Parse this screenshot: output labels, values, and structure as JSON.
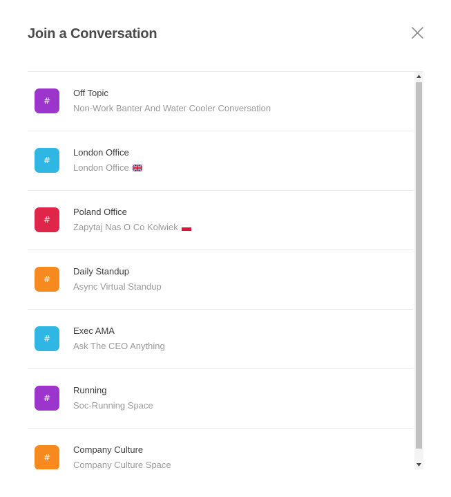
{
  "dialog": {
    "title": "Join a Conversation",
    "close_icon": "close-icon"
  },
  "channels": [
    {
      "icon": "hash-icon",
      "glyph": "#",
      "color": "#9c35cc",
      "name": "Off Topic",
      "description": "Non-Work Banter And Water Cooler Conversation",
      "flag": ""
    },
    {
      "icon": "hash-icon",
      "glyph": "#",
      "color": "#2fb6e3",
      "name": "London Office",
      "description": "London Office",
      "flag": "uk-flag-icon"
    },
    {
      "icon": "hash-icon",
      "glyph": "#",
      "color": "#e0254a",
      "name": "Poland Office",
      "description": "Zapytaj Nas O Co Kolwiek",
      "flag": "poland-flag-icon"
    },
    {
      "icon": "hash-icon",
      "glyph": "#",
      "color": "#f78a1f",
      "name": "Daily Standup",
      "description": "Async Virtual Standup",
      "flag": ""
    },
    {
      "icon": "hash-icon",
      "glyph": "#",
      "color": "#2fb6e3",
      "name": "Exec AMA",
      "description": "Ask The CEO Anything",
      "flag": ""
    },
    {
      "icon": "hash-icon",
      "glyph": "#",
      "color": "#9c35cc",
      "name": "Running",
      "description": "Soc-Running Space",
      "flag": ""
    },
    {
      "icon": "hash-icon",
      "glyph": "#",
      "color": "#f78a1f",
      "name": "Company Culture",
      "description": "Company Culture Space",
      "flag": ""
    }
  ],
  "scrollbar": {
    "up_icon": "arrow-up-icon",
    "down_icon": "arrow-down-icon"
  }
}
